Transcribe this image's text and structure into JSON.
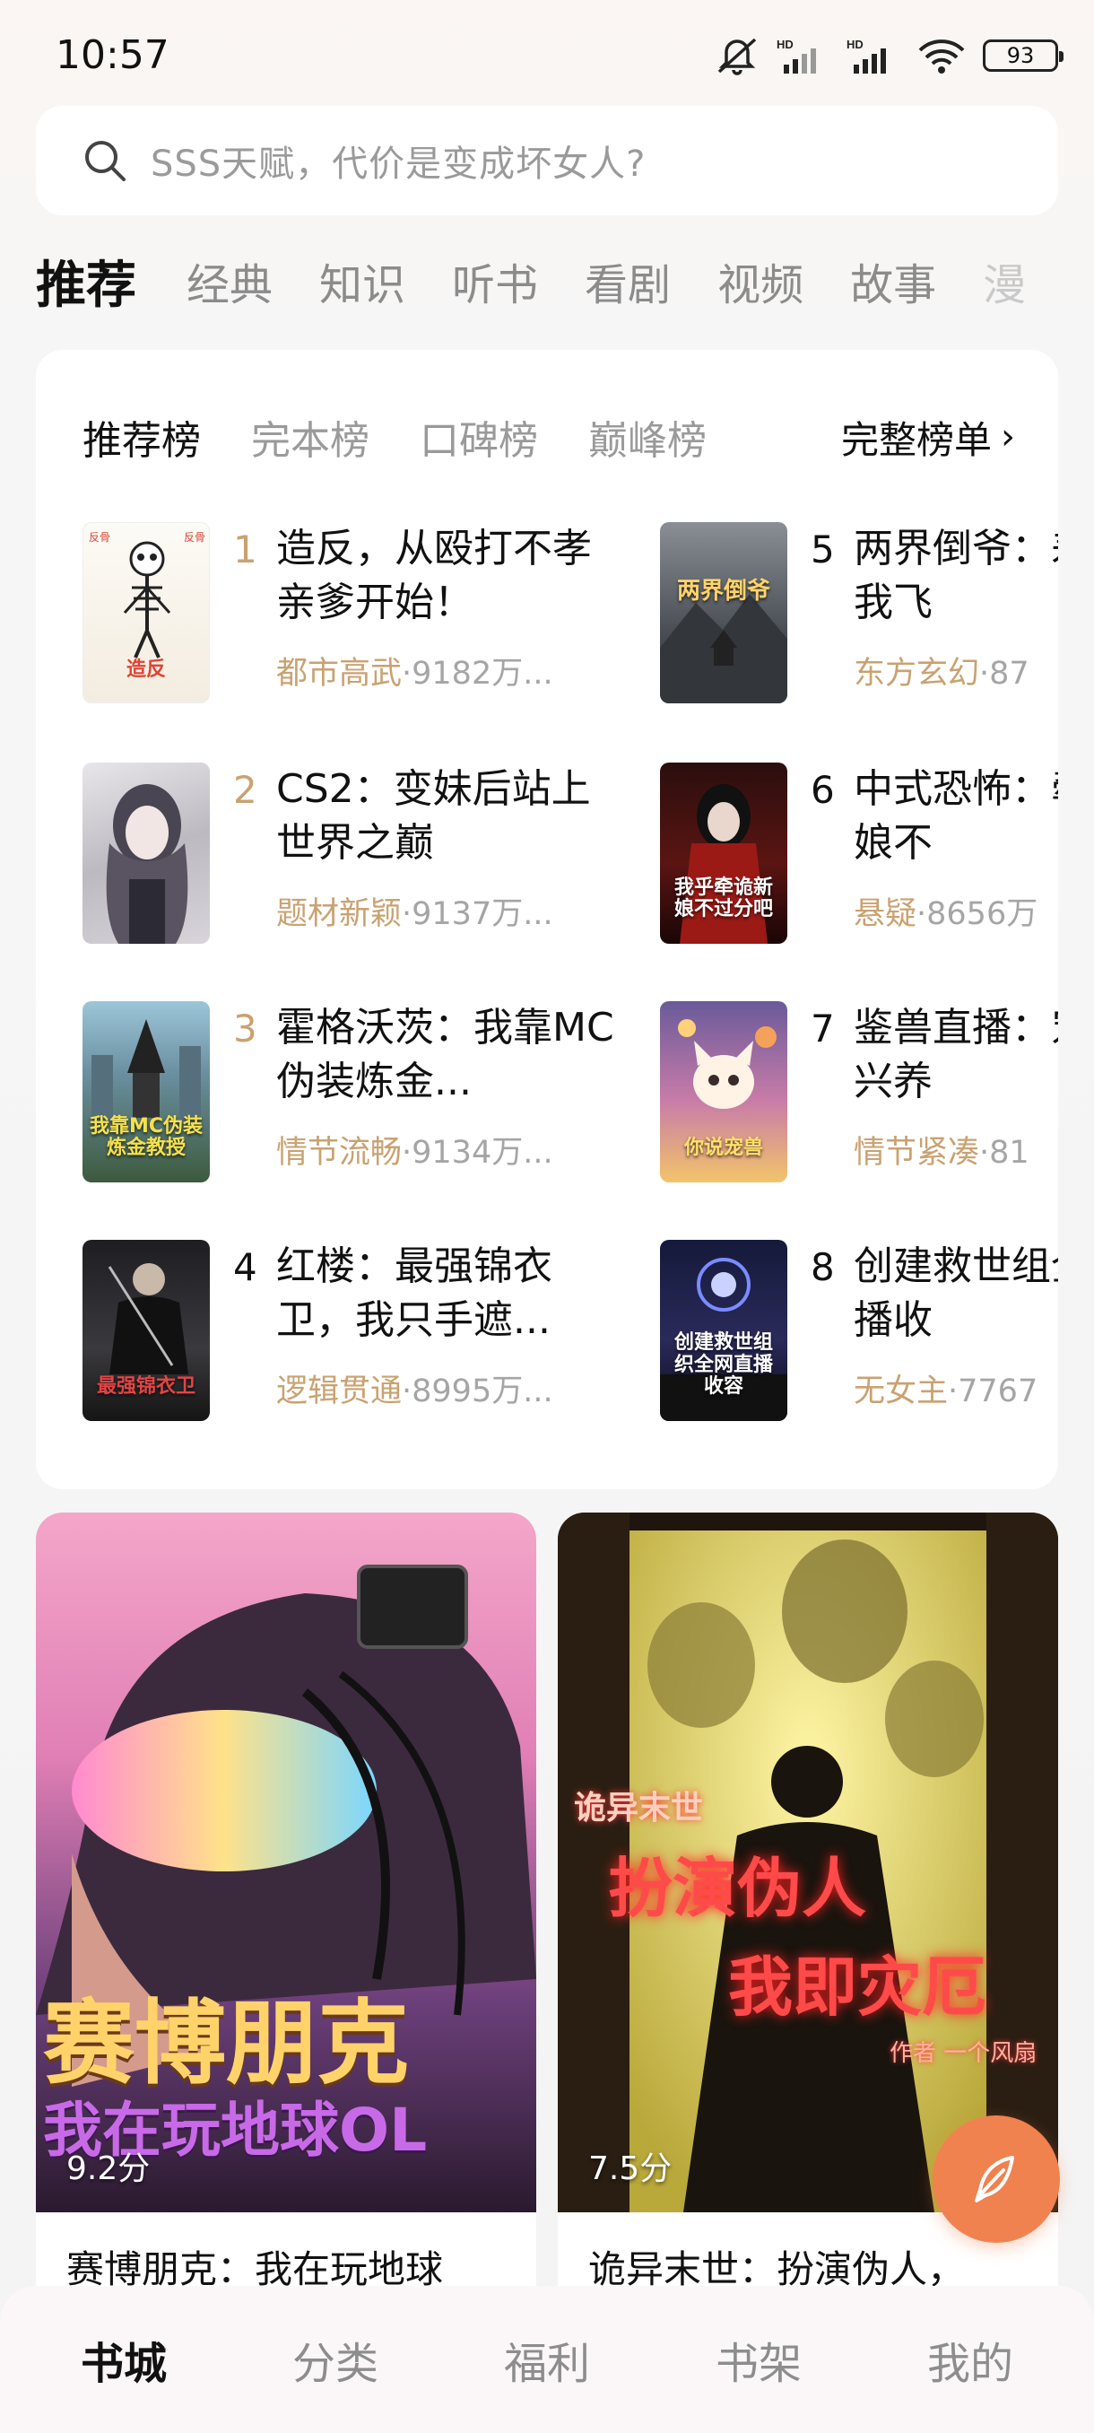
{
  "status": {
    "time": "10:57",
    "battery": "93"
  },
  "search": {
    "placeholder": "SSS天赋，代价是变成坏女人?"
  },
  "top_tabs": [
    "推荐",
    "经典",
    "知识",
    "听书",
    "看剧",
    "视频",
    "故事",
    "漫"
  ],
  "rank": {
    "tabs": [
      "推荐榜",
      "完本榜",
      "口碑榜",
      "巅峰榜"
    ],
    "full_label": "完整榜单",
    "items": [
      {
        "num": "1",
        "title": "造反，从殴打不孝亲爹开始！",
        "tag": "都市高武",
        "meta": "·9182万...",
        "cover_text": "造反"
      },
      {
        "num": "2",
        "title": "CS2：变妹后站上世界之巅",
        "tag": "题材新颖",
        "meta": "·9137万...",
        "cover_text": ""
      },
      {
        "num": "3",
        "title": "霍格沃茨：我靠MC伪装炼金...",
        "tag": "情节流畅",
        "meta": "·9134万...",
        "cover_text": "我靠MC伪装炼金教授"
      },
      {
        "num": "4",
        "title": "红楼：最强锦衣卫，我只手遮...",
        "tag": "逻辑贯通",
        "meta": "·8995万...",
        "cover_text": "最强锦衣卫"
      },
      {
        "num": "5",
        "title": "两界倒爷：差价助我飞",
        "tag": "东方玄幻",
        "meta": "·87",
        "cover_text": "两界倒爷"
      },
      {
        "num": "6",
        "title": "中式恐怖：牵诡新娘不",
        "tag": "悬疑",
        "meta": "·8656万",
        "cover_text": "我乎牵诡新娘不过分吧"
      },
      {
        "num": "7",
        "title": "鉴兽直播：宠兽不兴养",
        "tag": "情节紧凑",
        "meta": "·81",
        "cover_text": "你说宠兽"
      },
      {
        "num": "8",
        "title": "创建救世组全网直播收",
        "tag": "无女主",
        "meta": "·7767",
        "cover_text": "创建救世组织全网直播收容"
      }
    ]
  },
  "promos": [
    {
      "score": "9.2分",
      "title": "赛博朋克：我在玩地球",
      "art_line1": "赛博朋克",
      "art_line2": "我在玩地球OL"
    },
    {
      "score": "7.5分",
      "title": "诡异末世：扮演伪人，",
      "art_line1": "诡异末世",
      "art_line2": "扮演伪人",
      "art_line3": "我即灾厄",
      "art_author": "作者 一个风扇"
    }
  ],
  "bottom_nav": [
    "书城",
    "分类",
    "福利",
    "书架",
    "我的"
  ],
  "colors": {
    "accent_gold": "#c9a271",
    "fab": "#f0824f"
  }
}
